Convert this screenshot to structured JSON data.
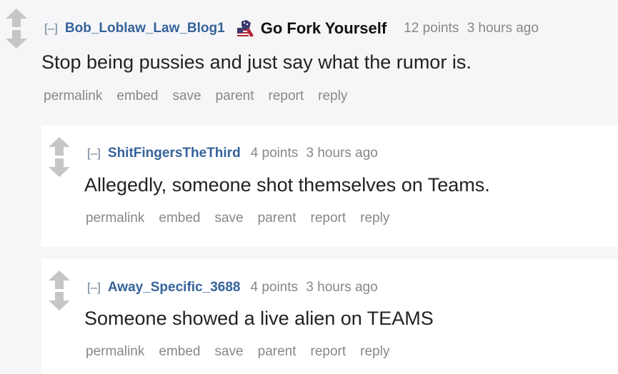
{
  "comments": [
    {
      "collapse": "[–]",
      "author": "Bob_Loblaw_Law_Blog1",
      "flair": {
        "icon": "raised-fist-flag-icon",
        "text": "Go Fork Yourself"
      },
      "points": "12 points",
      "time": "3 hours ago",
      "body": "Stop being pussies and just say what the rumor is.",
      "buttons": [
        "permalink",
        "embed",
        "save",
        "parent",
        "report",
        "reply"
      ]
    },
    {
      "collapse": "[–]",
      "author": "ShitFingersTheThird",
      "points": "4 points",
      "time": "3 hours ago",
      "body": "Allegedly, someone shot themselves on Teams.",
      "buttons": [
        "permalink",
        "embed",
        "save",
        "parent",
        "report",
        "reply"
      ]
    },
    {
      "collapse": "[–]",
      "author": "Away_Specific_3688",
      "points": "4 points",
      "time": "3 hours ago",
      "body": "Someone showed a live alien on TEAMS",
      "buttons": [
        "permalink",
        "embed",
        "save",
        "parent",
        "report",
        "reply"
      ]
    }
  ]
}
